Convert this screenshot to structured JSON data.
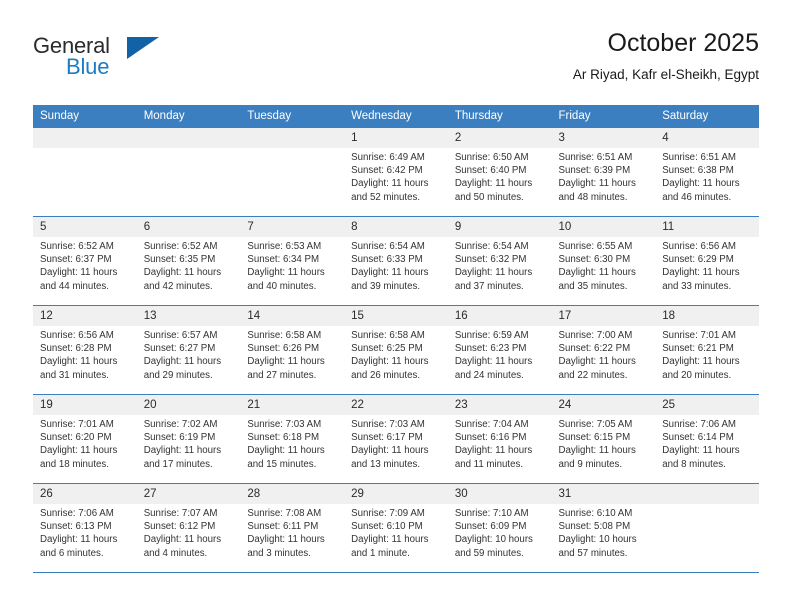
{
  "logo": {
    "word_top": "General",
    "word_bottom": "Blue",
    "triangle_color": "#1262a8",
    "blue_color": "#1b7dc4"
  },
  "header": {
    "title": "October 2025",
    "subtitle": "Ar Riyad, Kafr el-Sheikh, Egypt"
  },
  "theme": {
    "header_bg": "#3c7fc1",
    "daynum_bg": "#f0f0f0",
    "grid_line": "#3c7fc1"
  },
  "weekdays": [
    "Sunday",
    "Monday",
    "Tuesday",
    "Wednesday",
    "Thursday",
    "Friday",
    "Saturday"
  ],
  "labels": {
    "sunrise_prefix": "Sunrise: ",
    "sunset_prefix": "Sunset: ",
    "daylight_prefix": "Daylight: "
  },
  "weeks": [
    [
      {
        "day": "",
        "empty": true
      },
      {
        "day": "",
        "empty": true
      },
      {
        "day": "",
        "empty": true
      },
      {
        "day": "1",
        "sunrise": "Sunrise: 6:49 AM",
        "sunset": "Sunset: 6:42 PM",
        "daylight": "Daylight: 11 hours and 52 minutes."
      },
      {
        "day": "2",
        "sunrise": "Sunrise: 6:50 AM",
        "sunset": "Sunset: 6:40 PM",
        "daylight": "Daylight: 11 hours and 50 minutes."
      },
      {
        "day": "3",
        "sunrise": "Sunrise: 6:51 AM",
        "sunset": "Sunset: 6:39 PM",
        "daylight": "Daylight: 11 hours and 48 minutes."
      },
      {
        "day": "4",
        "sunrise": "Sunrise: 6:51 AM",
        "sunset": "Sunset: 6:38 PM",
        "daylight": "Daylight: 11 hours and 46 minutes."
      }
    ],
    [
      {
        "day": "5",
        "sunrise": "Sunrise: 6:52 AM",
        "sunset": "Sunset: 6:37 PM",
        "daylight": "Daylight: 11 hours and 44 minutes."
      },
      {
        "day": "6",
        "sunrise": "Sunrise: 6:52 AM",
        "sunset": "Sunset: 6:35 PM",
        "daylight": "Daylight: 11 hours and 42 minutes."
      },
      {
        "day": "7",
        "sunrise": "Sunrise: 6:53 AM",
        "sunset": "Sunset: 6:34 PM",
        "daylight": "Daylight: 11 hours and 40 minutes."
      },
      {
        "day": "8",
        "sunrise": "Sunrise: 6:54 AM",
        "sunset": "Sunset: 6:33 PM",
        "daylight": "Daylight: 11 hours and 39 minutes."
      },
      {
        "day": "9",
        "sunrise": "Sunrise: 6:54 AM",
        "sunset": "Sunset: 6:32 PM",
        "daylight": "Daylight: 11 hours and 37 minutes."
      },
      {
        "day": "10",
        "sunrise": "Sunrise: 6:55 AM",
        "sunset": "Sunset: 6:30 PM",
        "daylight": "Daylight: 11 hours and 35 minutes."
      },
      {
        "day": "11",
        "sunrise": "Sunrise: 6:56 AM",
        "sunset": "Sunset: 6:29 PM",
        "daylight": "Daylight: 11 hours and 33 minutes."
      }
    ],
    [
      {
        "day": "12",
        "sunrise": "Sunrise: 6:56 AM",
        "sunset": "Sunset: 6:28 PM",
        "daylight": "Daylight: 11 hours and 31 minutes."
      },
      {
        "day": "13",
        "sunrise": "Sunrise: 6:57 AM",
        "sunset": "Sunset: 6:27 PM",
        "daylight": "Daylight: 11 hours and 29 minutes."
      },
      {
        "day": "14",
        "sunrise": "Sunrise: 6:58 AM",
        "sunset": "Sunset: 6:26 PM",
        "daylight": "Daylight: 11 hours and 27 minutes."
      },
      {
        "day": "15",
        "sunrise": "Sunrise: 6:58 AM",
        "sunset": "Sunset: 6:25 PM",
        "daylight": "Daylight: 11 hours and 26 minutes."
      },
      {
        "day": "16",
        "sunrise": "Sunrise: 6:59 AM",
        "sunset": "Sunset: 6:23 PM",
        "daylight": "Daylight: 11 hours and 24 minutes."
      },
      {
        "day": "17",
        "sunrise": "Sunrise: 7:00 AM",
        "sunset": "Sunset: 6:22 PM",
        "daylight": "Daylight: 11 hours and 22 minutes."
      },
      {
        "day": "18",
        "sunrise": "Sunrise: 7:01 AM",
        "sunset": "Sunset: 6:21 PM",
        "daylight": "Daylight: 11 hours and 20 minutes."
      }
    ],
    [
      {
        "day": "19",
        "sunrise": "Sunrise: 7:01 AM",
        "sunset": "Sunset: 6:20 PM",
        "daylight": "Daylight: 11 hours and 18 minutes."
      },
      {
        "day": "20",
        "sunrise": "Sunrise: 7:02 AM",
        "sunset": "Sunset: 6:19 PM",
        "daylight": "Daylight: 11 hours and 17 minutes."
      },
      {
        "day": "21",
        "sunrise": "Sunrise: 7:03 AM",
        "sunset": "Sunset: 6:18 PM",
        "daylight": "Daylight: 11 hours and 15 minutes."
      },
      {
        "day": "22",
        "sunrise": "Sunrise: 7:03 AM",
        "sunset": "Sunset: 6:17 PM",
        "daylight": "Daylight: 11 hours and 13 minutes."
      },
      {
        "day": "23",
        "sunrise": "Sunrise: 7:04 AM",
        "sunset": "Sunset: 6:16 PM",
        "daylight": "Daylight: 11 hours and 11 minutes."
      },
      {
        "day": "24",
        "sunrise": "Sunrise: 7:05 AM",
        "sunset": "Sunset: 6:15 PM",
        "daylight": "Daylight: 11 hours and 9 minutes."
      },
      {
        "day": "25",
        "sunrise": "Sunrise: 7:06 AM",
        "sunset": "Sunset: 6:14 PM",
        "daylight": "Daylight: 11 hours and 8 minutes."
      }
    ],
    [
      {
        "day": "26",
        "sunrise": "Sunrise: 7:06 AM",
        "sunset": "Sunset: 6:13 PM",
        "daylight": "Daylight: 11 hours and 6 minutes."
      },
      {
        "day": "27",
        "sunrise": "Sunrise: 7:07 AM",
        "sunset": "Sunset: 6:12 PM",
        "daylight": "Daylight: 11 hours and 4 minutes."
      },
      {
        "day": "28",
        "sunrise": "Sunrise: 7:08 AM",
        "sunset": "Sunset: 6:11 PM",
        "daylight": "Daylight: 11 hours and 3 minutes."
      },
      {
        "day": "29",
        "sunrise": "Sunrise: 7:09 AM",
        "sunset": "Sunset: 6:10 PM",
        "daylight": "Daylight: 11 hours and 1 minute."
      },
      {
        "day": "30",
        "sunrise": "Sunrise: 7:10 AM",
        "sunset": "Sunset: 6:09 PM",
        "daylight": "Daylight: 10 hours and 59 minutes."
      },
      {
        "day": "31",
        "sunrise": "Sunrise: 6:10 AM",
        "sunset": "Sunset: 5:08 PM",
        "daylight": "Daylight: 10 hours and 57 minutes."
      }
    ]
  ]
}
